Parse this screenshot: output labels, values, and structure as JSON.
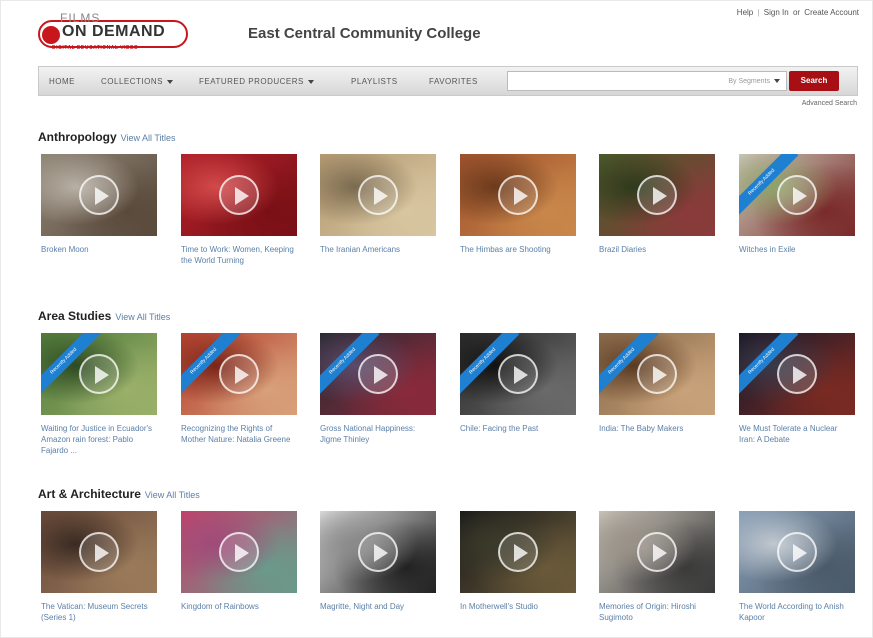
{
  "header": {
    "logo_films": "FILMS",
    "logo_main": "ON DEMAND",
    "logo_tag": "DIGITAL EDUCATIONAL VIDEO",
    "college_name": "East Central Community College",
    "links": {
      "help": "Help",
      "sign_in": "Sign In",
      "or": "or",
      "create_account": "Create Account"
    }
  },
  "nav": {
    "home": "HOME",
    "collections": "COLLECTIONS",
    "featured_producers": "FEATURED PRODUCERS",
    "playlists": "PLAYLISTS",
    "favorites": "FAVORITES",
    "search_scope": "By Segments",
    "search_button": "Search",
    "advanced_search": "Advanced Search"
  },
  "sections": [
    {
      "title": "Anthropology",
      "view_all": "View All Titles",
      "tiles": [
        {
          "title": "Broken Moon",
          "ribbon": "",
          "colors": [
            "#8f8576",
            "#5a4a3c",
            "#b8b0a4"
          ]
        },
        {
          "title": "Time to Work: Women, Keeping the World Turning",
          "ribbon": "",
          "colors": [
            "#b2212a",
            "#7a1016",
            "#d24a4a"
          ]
        },
        {
          "title": "The Iranian Americans",
          "ribbon": "",
          "colors": [
            "#b49a72",
            "#d8c6a0",
            "#7b6a4f"
          ]
        },
        {
          "title": "The Himbas are Shooting",
          "ribbon": "",
          "colors": [
            "#a0522d",
            "#c9874a",
            "#6b3a1c"
          ]
        },
        {
          "title": "Brazil Diaries",
          "ribbon": "",
          "colors": [
            "#4a5a2a",
            "#8b3a3a",
            "#2e3a1c"
          ]
        },
        {
          "title": "Witches in Exile",
          "ribbon": "Recently Added",
          "colors": [
            "#c9c6b6",
            "#7a2a2a",
            "#8fa36a"
          ]
        }
      ]
    },
    {
      "title": "Area Studies",
      "view_all": "View All Titles",
      "tiles": [
        {
          "title": "Waiting for Justice in Ecuador's Amazon rain forest: Pablo Fajardo ...",
          "ribbon": "Recently Added",
          "colors": [
            "#4f7a3a",
            "#9ab06a",
            "#2e4a22"
          ]
        },
        {
          "title": "Recognizing the Rights of Mother Nature: Natalia Greene",
          "ribbon": "Recently Added",
          "colors": [
            "#b5402e",
            "#d8a07a",
            "#7a2418"
          ]
        },
        {
          "title": "Gross National Happiness: Jigme Thinley",
          "ribbon": "Recently Added",
          "colors": [
            "#2a2a34",
            "#8a2a3a",
            "#5a4a6a"
          ]
        },
        {
          "title": "Chile: Facing the Past",
          "ribbon": "Recently Added",
          "colors": [
            "#2a2a2a",
            "#6a6a6a",
            "#111111"
          ]
        },
        {
          "title": "India: The Baby Makers",
          "ribbon": "Recently Added",
          "colors": [
            "#8a6a4a",
            "#c8a27a",
            "#5a3a22"
          ]
        },
        {
          "title": "We Must Tolerate a Nuclear Iran: A Debate",
          "ribbon": "Recently Added",
          "colors": [
            "#1a1a2a",
            "#7a2a22",
            "#3a3a4a"
          ]
        }
      ]
    },
    {
      "title": "Art & Architecture",
      "view_all": "View All Titles",
      "tiles": [
        {
          "title": "The Vatican: Museum Secrets (Series 1)",
          "ribbon": "",
          "colors": [
            "#6a4a3a",
            "#9a7a5a",
            "#3a2a22"
          ]
        },
        {
          "title": "Kingdom of Rainbows",
          "ribbon": "",
          "colors": [
            "#c2406a",
            "#6a9a8a",
            "#a04a7a"
          ]
        },
        {
          "title": "Magritte, Night and Day",
          "ribbon": "",
          "colors": [
            "#d8d8d8",
            "#222222",
            "#8a8a8a"
          ]
        },
        {
          "title": "In Motherwell's Studio",
          "ribbon": "",
          "colors": [
            "#1a1a1a",
            "#6a5a3a",
            "#3a3a2a"
          ]
        },
        {
          "title": "Memories of Origin: Hiroshi Sugimoto",
          "ribbon": "",
          "colors": [
            "#c8c2b8",
            "#3a3a3a",
            "#9a9288"
          ]
        },
        {
          "title": "The World According to Anish Kapoor",
          "ribbon": "",
          "colors": [
            "#8aa0b8",
            "#4a5a6a",
            "#c0c8d0"
          ]
        }
      ]
    }
  ]
}
